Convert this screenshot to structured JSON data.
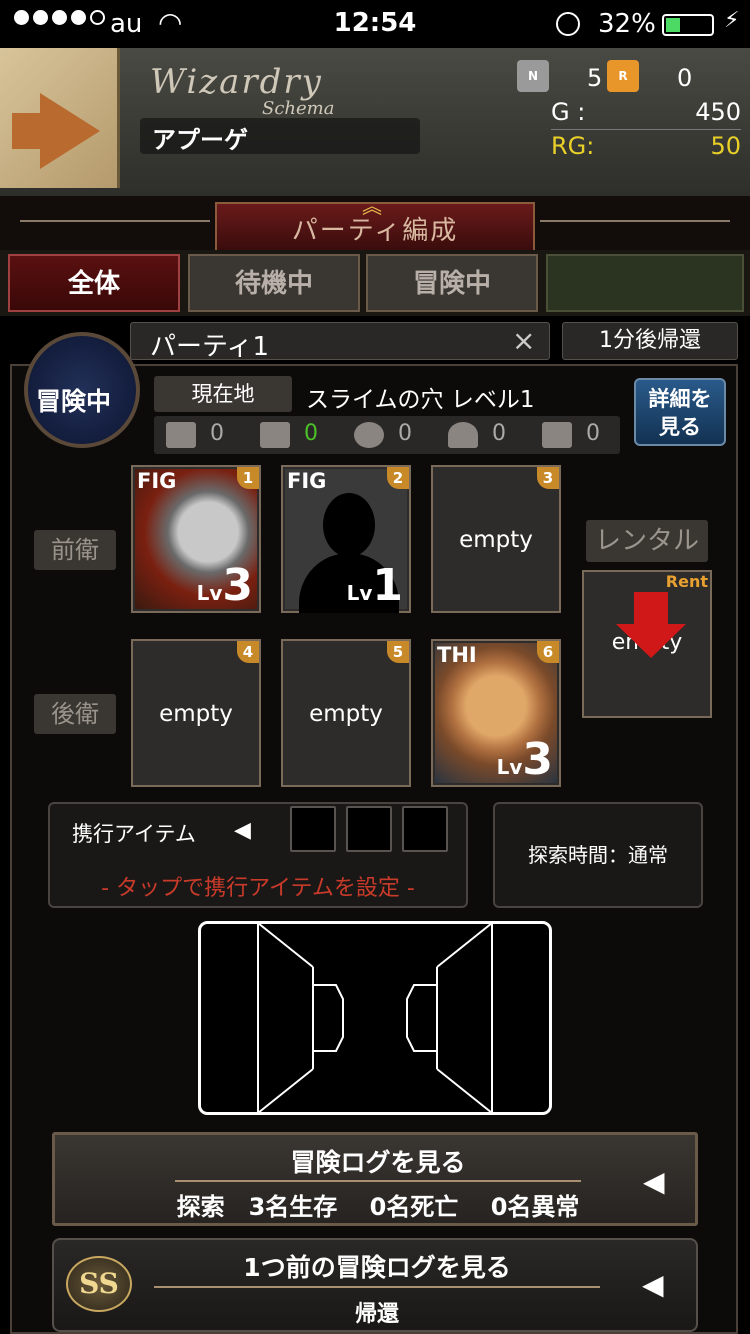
{
  "status_bar": {
    "carrier": "au",
    "time": "12:54",
    "battery": "32%",
    "battery_level": 0.32
  },
  "header": {
    "logo": "Wizardry",
    "logo_sub": "Schema",
    "player_name": "アプーゲ",
    "n_tickets": "5",
    "r_tickets": "0",
    "gold_label": "G :",
    "gold_value": "450",
    "rg_label": "RG:",
    "rg_value": "50",
    "rg_color": "#e8d028"
  },
  "title": "パーティ編成",
  "tabs": [
    {
      "label": "全体",
      "active": true
    },
    {
      "label": "待機中",
      "active": false
    },
    {
      "label": "冒険中",
      "active": false
    }
  ],
  "party": {
    "name": "パーティ1",
    "clear_symbol": "×",
    "return_label": "1分後帰還",
    "status": "冒険中",
    "location_label": "現在地",
    "location": "スライムの穴 レベル1",
    "detail_button": [
      "詳細を",
      "見る"
    ],
    "counters": [
      {
        "icon": "monster-icon",
        "value": "0",
        "highlight": false
      },
      {
        "icon": "treasure-chest-icon",
        "value": "0",
        "highlight": true
      },
      {
        "icon": "trap-ring-icon",
        "value": "0",
        "highlight": false
      },
      {
        "icon": "bell-icon",
        "value": "0",
        "highlight": false
      },
      {
        "icon": "hot-spring-icon",
        "value": "0",
        "highlight": false
      }
    ]
  },
  "rows": {
    "front": "前衛",
    "back": "後衛"
  },
  "slots": [
    {
      "num": "1",
      "class": "FIG",
      "lv_label": "Lv",
      "level": "3",
      "empty": ""
    },
    {
      "num": "2",
      "class": "FIG",
      "lv_label": "Lv",
      "level": "1",
      "empty": ""
    },
    {
      "num": "3",
      "class": "",
      "lv_label": "",
      "level": "",
      "empty": "empty"
    },
    {
      "num": "4",
      "class": "",
      "lv_label": "",
      "level": "",
      "empty": "empty"
    },
    {
      "num": "5",
      "class": "",
      "lv_label": "",
      "level": "",
      "empty": "empty"
    },
    {
      "num": "6",
      "class": "THI",
      "lv_label": "Lv",
      "level": "3",
      "empty": ""
    }
  ],
  "rental": {
    "label": "レンタル",
    "badge": "Rent",
    "empty": "empty"
  },
  "items": {
    "title": "携行アイテム",
    "arrow": "◀",
    "hint": "- タップで携行アイテムを設定 -"
  },
  "explore_time": "探索時間：通常",
  "log_button": {
    "title": "冒険ログを見る",
    "summary": "探索　3名生存　 0名死亡　 0名異常",
    "arrow": "◀"
  },
  "prev_log_button": {
    "badge": "SS",
    "title": "1つ前の冒険ログを見る",
    "subtitle": "帰還",
    "arrow": "◀"
  }
}
